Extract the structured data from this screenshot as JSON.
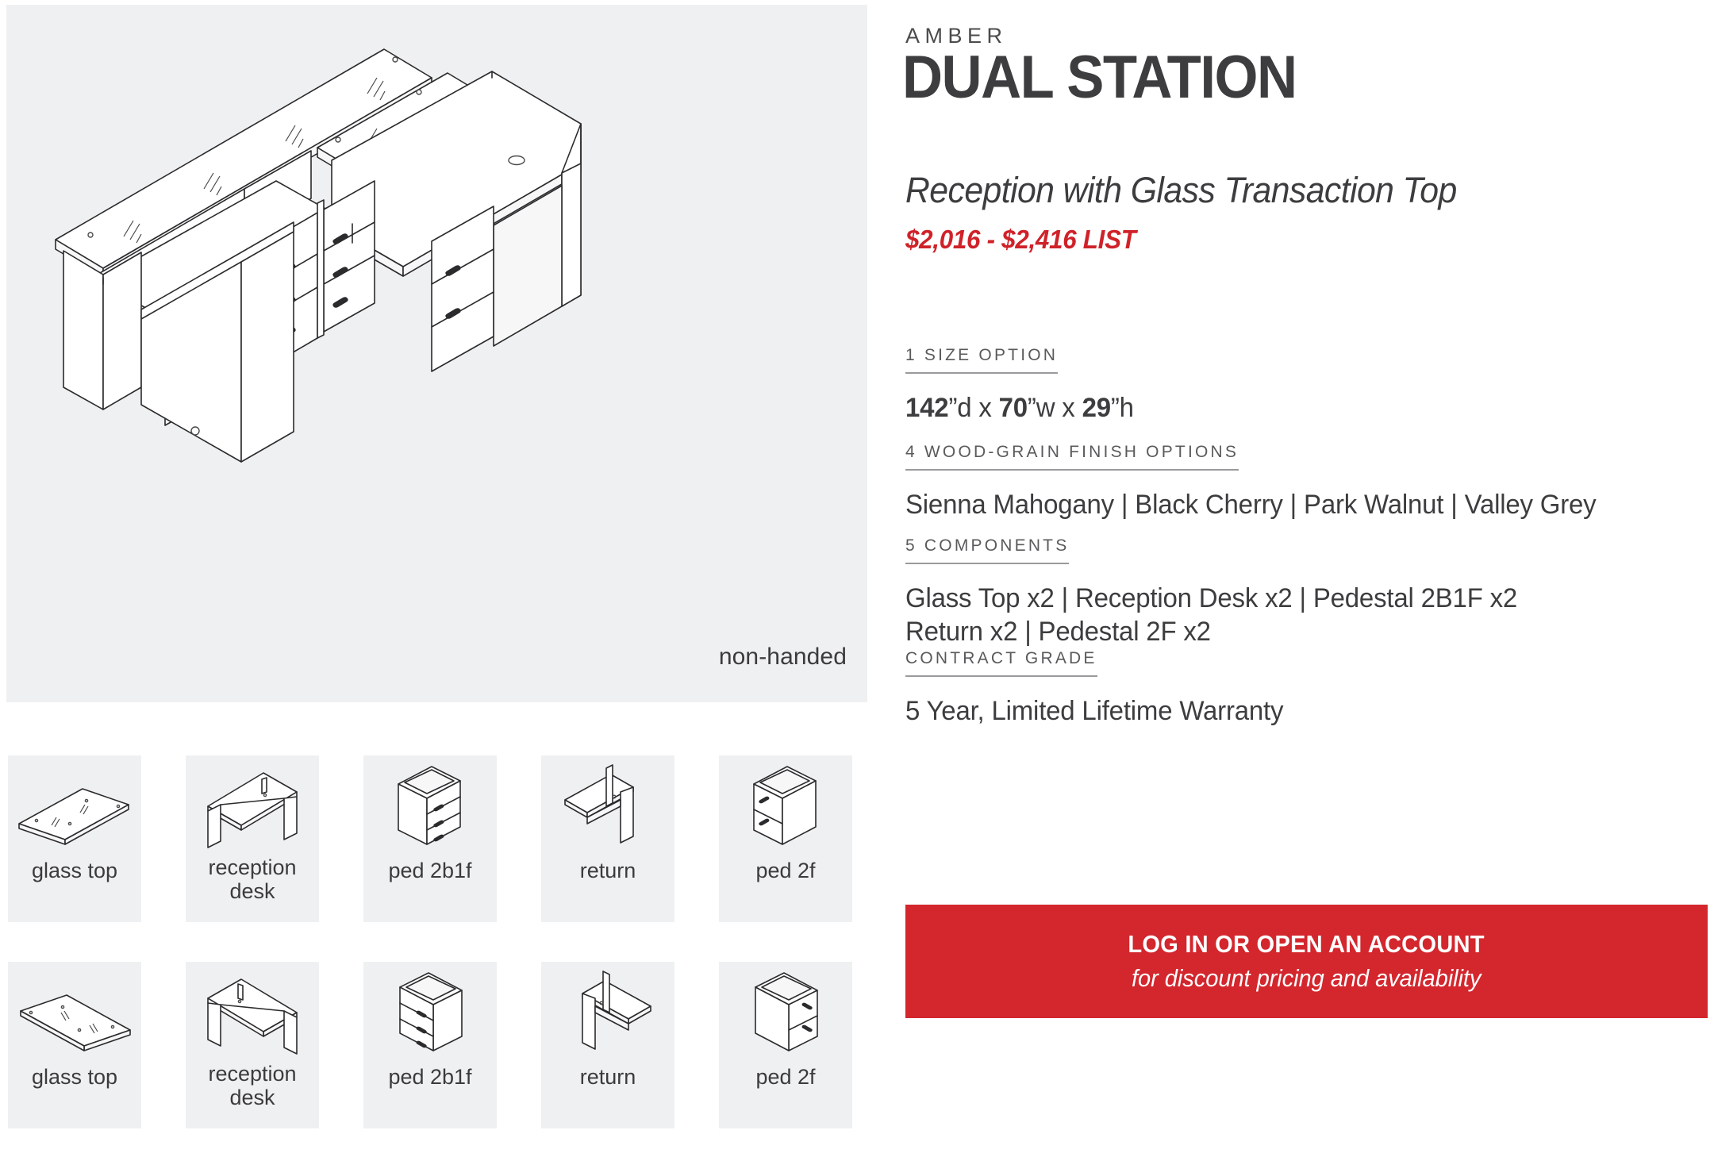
{
  "product": {
    "brand": "AMBER",
    "name": "DUAL STATION",
    "subtitle": "Reception with Glass Transaction Top",
    "price": "$2,016 - $2,416 LIST",
    "handed_label": "non-handed"
  },
  "specs": {
    "size": {
      "heading": "1 SIZE OPTION",
      "depth_value": "142",
      "depth_unit": "”d x ",
      "width_value": "70",
      "width_unit": "”w x ",
      "height_value": "29",
      "height_unit": "”h"
    },
    "finish": {
      "heading": "4 WOOD-GRAIN FINISH OPTIONS",
      "value": "Sienna Mahogany | Black Cherry | Park Walnut | Valley Grey"
    },
    "components": {
      "heading": "5 COMPONENTS",
      "line1": "Glass Top x2 | Reception Desk x2 | Pedestal 2B1F x2",
      "line2": "Return x2 | Pedestal 2F x2"
    },
    "warranty": {
      "heading": "CONTRACT GRADE",
      "value": "5 Year, Limited Lifetime Warranty"
    }
  },
  "cta": {
    "primary": "LOG IN OR OPEN AN ACCOUNT",
    "secondary": "for discount pricing and availability"
  },
  "thumbnails": {
    "row1": [
      {
        "label": "glass top",
        "art": "glass-top"
      },
      {
        "label": "reception desk",
        "art": "reception-desk"
      },
      {
        "label": "ped 2b1f",
        "art": "ped-2b1f"
      },
      {
        "label": "return",
        "art": "return"
      },
      {
        "label": "ped 2f",
        "art": "ped-2f"
      }
    ],
    "row2": [
      {
        "label": "glass top",
        "art": "glass-top-mirror"
      },
      {
        "label": "reception desk",
        "art": "reception-desk-mirror"
      },
      {
        "label": "ped 2b1f",
        "art": "ped-2b1f-mirror"
      },
      {
        "label": "return",
        "art": "return-mirror"
      },
      {
        "label": "ped 2f",
        "art": "ped-2f-mirror"
      }
    ]
  },
  "colors": {
    "accent_red": "#d3262d",
    "price_red": "#cf2229",
    "panel_gray": "#eff0f2",
    "text_dark": "#3d3d3f"
  }
}
